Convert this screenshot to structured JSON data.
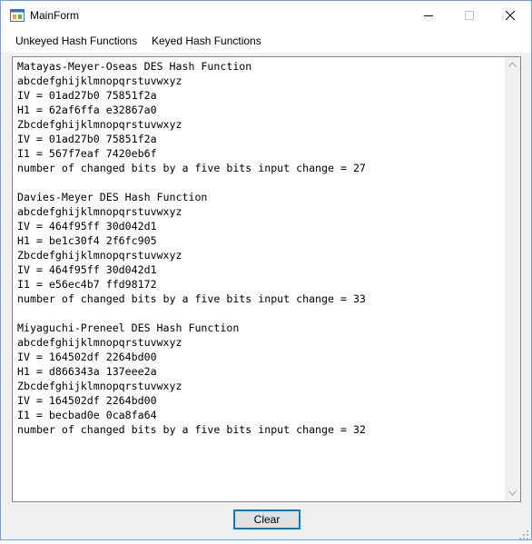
{
  "window": {
    "title": "MainForm",
    "icon": "app-form-icon",
    "caption_buttons": {
      "minimize": "minimize-icon",
      "maximize": "maximize-icon",
      "close": "close-icon"
    }
  },
  "menu": {
    "items": [
      {
        "label": "Unkeyed Hash Functions"
      },
      {
        "label": "Keyed Hash Functions"
      }
    ]
  },
  "output": {
    "lines": [
      "Matayas-Meyer-Oseas DES Hash Function",
      "abcdefghijklmnopqrstuvwxyz",
      "IV = 01ad27b0 75851f2a",
      "H1 = 62af6ffa e32867a0",
      "Zbcdefghijklmnopqrstuvwxyz",
      "IV = 01ad27b0 75851f2a",
      "I1 = 567f7eaf 7420eb6f",
      "number of changed bits by a five bits input change = 27",
      "",
      "Davies-Meyer DES Hash Function",
      "abcdefghijklmnopqrstuvwxyz",
      "IV = 464f95ff 30d042d1",
      "H1 = be1c30f4 2f6fc905",
      "Zbcdefghijklmnopqrstuvwxyz",
      "IV = 464f95ff 30d042d1",
      "I1 = e56ec4b7 ffd98172",
      "number of changed bits by a five bits input change = 33",
      "",
      "Miyaguchi-Preneel DES Hash Function",
      "abcdefghijklmnopqrstuvwxyz",
      "IV = 164502df 2264bd00",
      "H1 = d866343a 137eee2a",
      "Zbcdefghijklmnopqrstuvwxyz",
      "IV = 164502df 2264bd00",
      "I1 = becbad0e 0ca8fa64",
      "number of changed bits by a five bits input change = 32"
    ]
  },
  "buttons": {
    "clear_label": "Clear"
  },
  "colors": {
    "accent": "#0078d7",
    "window_border": "#7a9cd3",
    "form_background": "#f0f0f0"
  }
}
